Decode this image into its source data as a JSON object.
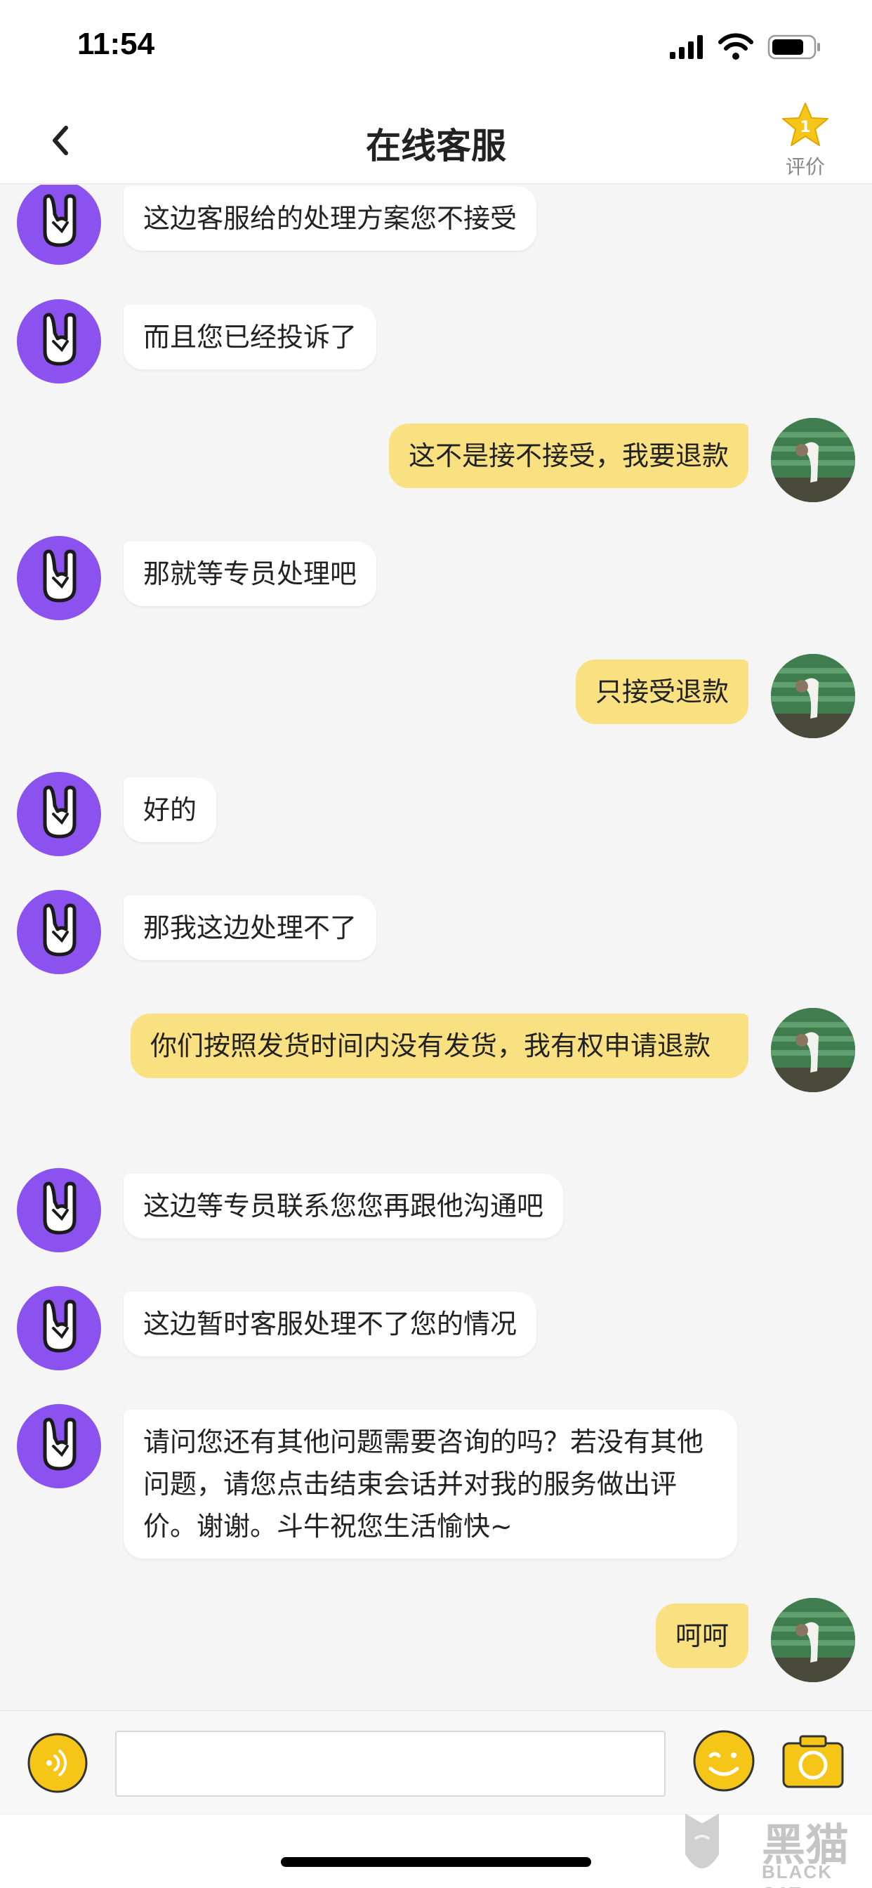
{
  "status_bar": {
    "time": "11:54"
  },
  "nav": {
    "title": "在线客服",
    "rate_label": "评价"
  },
  "messages": [
    {
      "sender": "cs",
      "text": "这边客服给的处理方案您不接受"
    },
    {
      "sender": "cs",
      "text": "而且您已经投诉了"
    },
    {
      "sender": "user",
      "text": "这不是接不接受，我要退款"
    },
    {
      "sender": "cs",
      "text": "那就等专员处理吧"
    },
    {
      "sender": "user",
      "text": "只接受退款"
    },
    {
      "sender": "cs",
      "text": "好的"
    },
    {
      "sender": "cs",
      "text": "那我这边处理不了"
    },
    {
      "sender": "user",
      "text": "你们按照发货时间内没有发货，我有权申请退款"
    },
    {
      "sender": "cs",
      "text": "这边等专员联系您您再跟他沟通吧"
    },
    {
      "sender": "cs",
      "text": "这边暂时客服处理不了您的情况"
    },
    {
      "sender": "cs",
      "text": "请问您还有其他问题需要咨询的吗？若没有其他问题，请您点击结束会话并对我的服务做出评价。谢谢。斗牛祝您生活愉快~"
    },
    {
      "sender": "user",
      "text": "呵呵"
    }
  ],
  "input": {
    "value": "",
    "placeholder": ""
  },
  "watermark": {
    "cn": "黑猫",
    "en": "BLACK CAT"
  },
  "colors": {
    "cs_avatar": "#8b52f0",
    "user_bubble": "#f9e081",
    "accent_yellow": "#f5c518"
  }
}
